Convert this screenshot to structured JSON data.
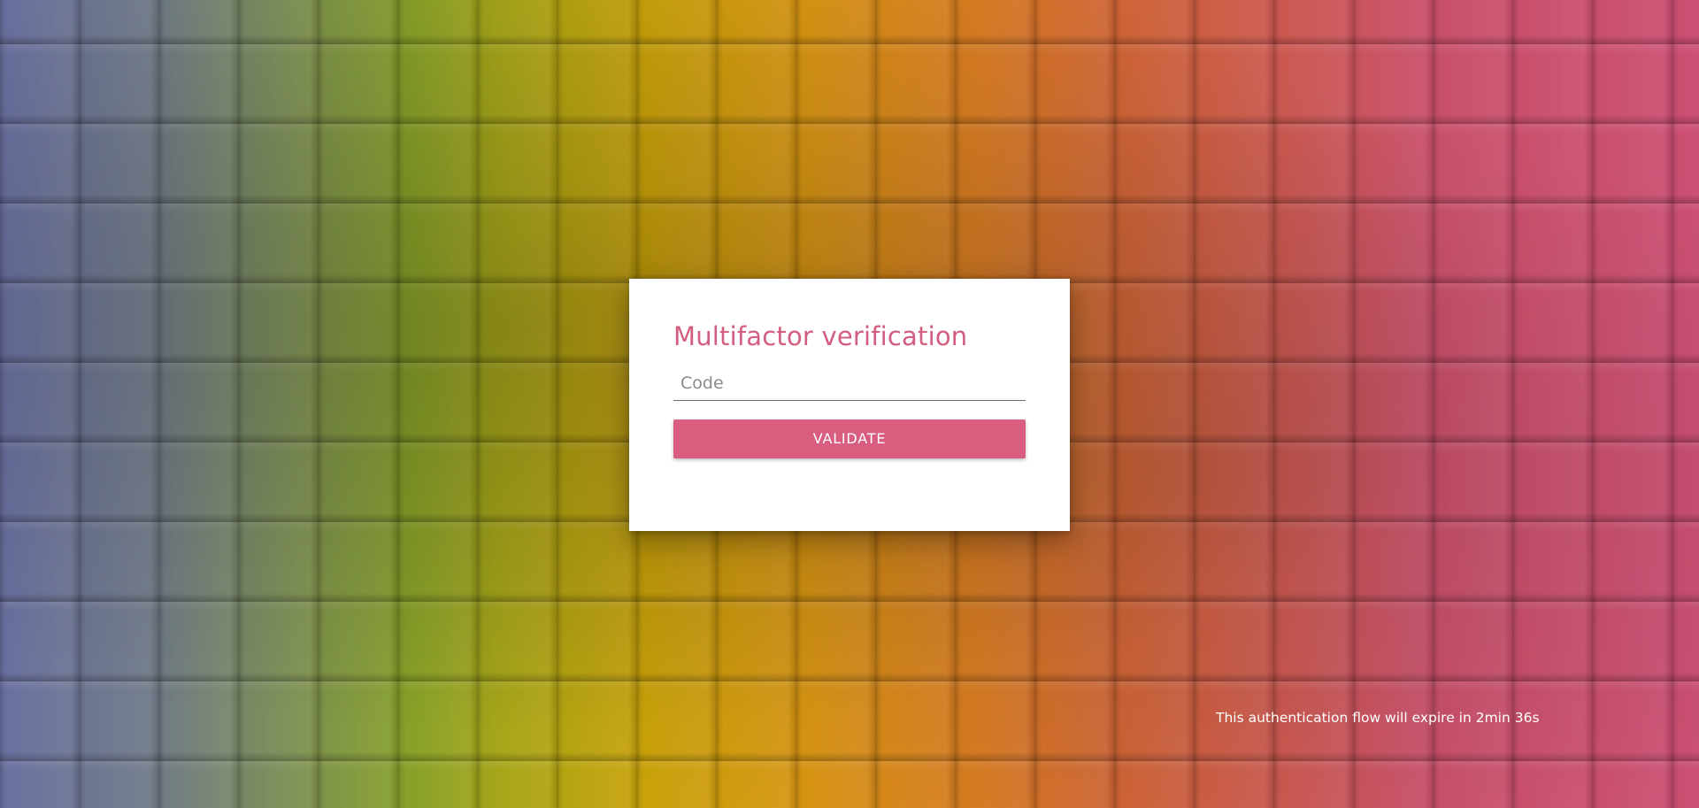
{
  "login": {
    "title": "Multifactor verification",
    "code_placeholder": "Code",
    "code_value": "",
    "validate_label": "VALIDATE"
  },
  "footer": {
    "expire_text": "This authentication flow will expire in 2min 36s"
  },
  "colors": {
    "accent": "#d85d7e",
    "card_background": "#ffffff",
    "text_on_background": "#ffffff"
  }
}
